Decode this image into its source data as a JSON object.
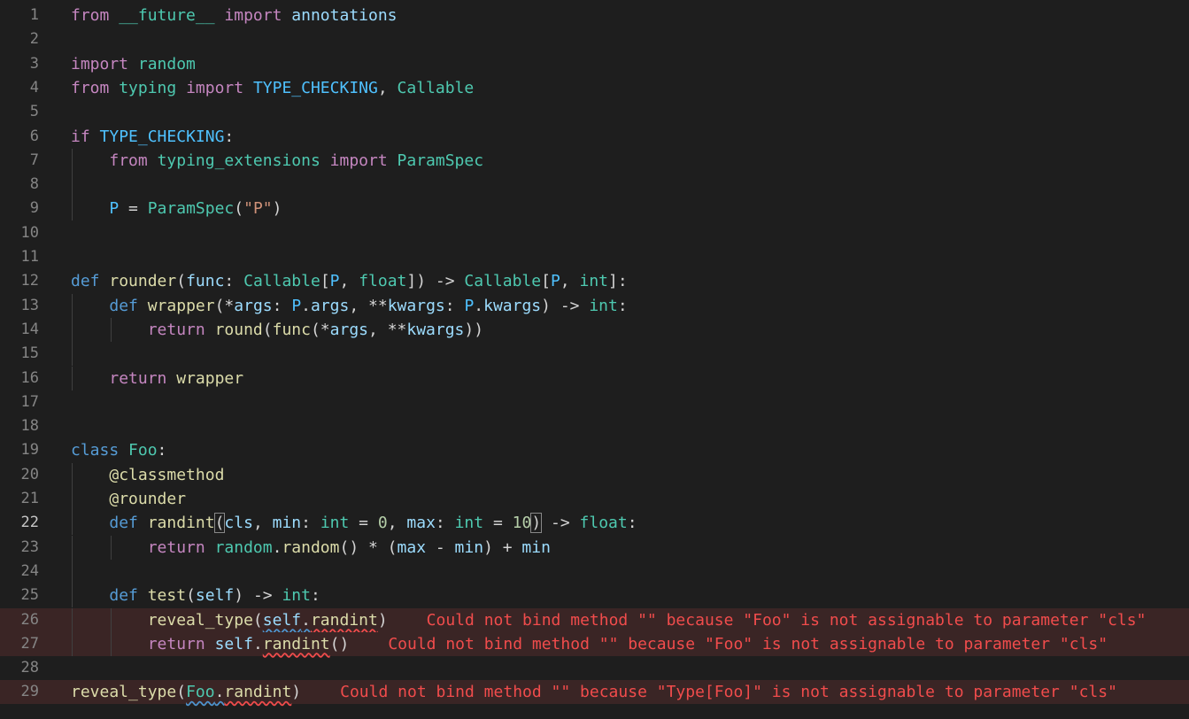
{
  "editor": {
    "language": "python",
    "active_line": 22,
    "colors": {
      "background": "#1e1e1e",
      "error_line": "#3a2525",
      "error_text": "#f14c4c",
      "keyword": "#c586c0",
      "storage": "#569cd6",
      "function": "#dcdcaa",
      "type": "#4ec9b0",
      "variable": "#9cdcfe",
      "string": "#ce9178",
      "number": "#b5cea8"
    },
    "line_numbers": [
      "1",
      "2",
      "3",
      "4",
      "5",
      "6",
      "7",
      "8",
      "9",
      "10",
      "11",
      "12",
      "13",
      "14",
      "15",
      "16",
      "17",
      "18",
      "19",
      "20",
      "21",
      "22",
      "23",
      "24",
      "25",
      "26",
      "27",
      "28",
      "29"
    ],
    "lines": [
      {
        "t": [
          [
            "kw",
            "from"
          ],
          [
            "op",
            " "
          ],
          [
            "ty",
            "__future__"
          ],
          [
            "op",
            " "
          ],
          [
            "kw",
            "import"
          ],
          [
            "op",
            " "
          ],
          [
            "var",
            "annotations"
          ]
        ]
      },
      {
        "t": []
      },
      {
        "t": [
          [
            "kw",
            "import"
          ],
          [
            "op",
            " "
          ],
          [
            "ty",
            "random"
          ]
        ]
      },
      {
        "t": [
          [
            "kw",
            "from"
          ],
          [
            "op",
            " "
          ],
          [
            "ty",
            "typing"
          ],
          [
            "op",
            " "
          ],
          [
            "kw",
            "import"
          ],
          [
            "op",
            " "
          ],
          [
            "con",
            "TYPE_CHECKING"
          ],
          [
            "op",
            ", "
          ],
          [
            "ty",
            "Callable"
          ]
        ]
      },
      {
        "t": []
      },
      {
        "t": [
          [
            "kw",
            "if"
          ],
          [
            "op",
            " "
          ],
          [
            "con",
            "TYPE_CHECKING"
          ],
          [
            "op",
            ":"
          ]
        ]
      },
      {
        "g": 1,
        "t": [
          [
            "op",
            "    "
          ],
          [
            "kw",
            "from"
          ],
          [
            "op",
            " "
          ],
          [
            "ty",
            "typing_extensions"
          ],
          [
            "op",
            " "
          ],
          [
            "kw",
            "import"
          ],
          [
            "op",
            " "
          ],
          [
            "ty",
            "ParamSpec"
          ]
        ]
      },
      {
        "g": 1,
        "t": []
      },
      {
        "g": 1,
        "t": [
          [
            "op",
            "    "
          ],
          [
            "con",
            "P"
          ],
          [
            "op",
            " = "
          ],
          [
            "ty",
            "ParamSpec"
          ],
          [
            "op",
            "("
          ],
          [
            "str",
            "\"P\""
          ],
          [
            "op",
            ")"
          ]
        ]
      },
      {
        "t": []
      },
      {
        "t": []
      },
      {
        "t": [
          [
            "kw2",
            "def"
          ],
          [
            "op",
            " "
          ],
          [
            "fn",
            "rounder"
          ],
          [
            "op",
            "("
          ],
          [
            "var",
            "func"
          ],
          [
            "op",
            ": "
          ],
          [
            "ty",
            "Callable"
          ],
          [
            "op",
            "["
          ],
          [
            "con",
            "P"
          ],
          [
            "op",
            ", "
          ],
          [
            "ty",
            "float"
          ],
          [
            "op",
            "]) -> "
          ],
          [
            "ty",
            "Callable"
          ],
          [
            "op",
            "["
          ],
          [
            "con",
            "P"
          ],
          [
            "op",
            ", "
          ],
          [
            "ty",
            "int"
          ],
          [
            "op",
            "]:"
          ]
        ]
      },
      {
        "g": 1,
        "t": [
          [
            "op",
            "    "
          ],
          [
            "kw2",
            "def"
          ],
          [
            "op",
            " "
          ],
          [
            "fn",
            "wrapper"
          ],
          [
            "op",
            "(*"
          ],
          [
            "var",
            "args"
          ],
          [
            "op",
            ": "
          ],
          [
            "con",
            "P"
          ],
          [
            "op",
            "."
          ],
          [
            "var",
            "args"
          ],
          [
            "op",
            ", **"
          ],
          [
            "var",
            "kwargs"
          ],
          [
            "op",
            ": "
          ],
          [
            "con",
            "P"
          ],
          [
            "op",
            "."
          ],
          [
            "var",
            "kwargs"
          ],
          [
            "op",
            ") -> "
          ],
          [
            "ty",
            "int"
          ],
          [
            "op",
            ":"
          ]
        ]
      },
      {
        "g": 2,
        "t": [
          [
            "op",
            "        "
          ],
          [
            "kw",
            "return"
          ],
          [
            "op",
            " "
          ],
          [
            "fn",
            "round"
          ],
          [
            "op",
            "("
          ],
          [
            "fn",
            "func"
          ],
          [
            "op",
            "(*"
          ],
          [
            "var",
            "args"
          ],
          [
            "op",
            ", **"
          ],
          [
            "var",
            "kwargs"
          ],
          [
            "op",
            "))"
          ]
        ]
      },
      {
        "g": 1,
        "t": []
      },
      {
        "g": 1,
        "t": [
          [
            "op",
            "    "
          ],
          [
            "kw",
            "return"
          ],
          [
            "op",
            " "
          ],
          [
            "fn",
            "wrapper"
          ]
        ]
      },
      {
        "t": []
      },
      {
        "t": []
      },
      {
        "t": [
          [
            "kw2",
            "class"
          ],
          [
            "op",
            " "
          ],
          [
            "ty",
            "Foo"
          ],
          [
            "op",
            ":"
          ]
        ]
      },
      {
        "g": 1,
        "t": [
          [
            "op",
            "    "
          ],
          [
            "fn",
            "@classmethod"
          ]
        ]
      },
      {
        "g": 1,
        "t": [
          [
            "op",
            "    "
          ],
          [
            "fn",
            "@rounder"
          ]
        ]
      },
      {
        "g": 1,
        "t": [
          [
            "op",
            "    "
          ],
          [
            "kw2",
            "def"
          ],
          [
            "op",
            " "
          ],
          [
            "fn",
            "randint"
          ],
          [
            "br",
            "("
          ],
          [
            "var",
            "cls"
          ],
          [
            "op",
            ", "
          ],
          [
            "var",
            "min"
          ],
          [
            "op",
            ": "
          ],
          [
            "ty",
            "int"
          ],
          [
            "op",
            " = "
          ],
          [
            "num",
            "0"
          ],
          [
            "op",
            ", "
          ],
          [
            "var",
            "max"
          ],
          [
            "op",
            ": "
          ],
          [
            "ty",
            "int"
          ],
          [
            "op",
            " = "
          ],
          [
            "num",
            "10"
          ],
          [
            "br",
            ")"
          ],
          [
            "op",
            " -> "
          ],
          [
            "ty",
            "float"
          ],
          [
            "op",
            ":"
          ]
        ]
      },
      {
        "g": 2,
        "t": [
          [
            "op",
            "        "
          ],
          [
            "kw",
            "return"
          ],
          [
            "op",
            " "
          ],
          [
            "ty",
            "random"
          ],
          [
            "op",
            "."
          ],
          [
            "fn",
            "random"
          ],
          [
            "op",
            "() * ("
          ],
          [
            "var",
            "max"
          ],
          [
            "op",
            " - "
          ],
          [
            "var",
            "min"
          ],
          [
            "op",
            ") + "
          ],
          [
            "var",
            "min"
          ]
        ]
      },
      {
        "g": 1,
        "t": []
      },
      {
        "g": 1,
        "t": [
          [
            "op",
            "    "
          ],
          [
            "kw2",
            "def"
          ],
          [
            "op",
            " "
          ],
          [
            "fn",
            "test"
          ],
          [
            "op",
            "("
          ],
          [
            "var",
            "self"
          ],
          [
            "op",
            ") -> "
          ],
          [
            "ty",
            "int"
          ],
          [
            "op",
            ":"
          ]
        ]
      },
      {
        "g": 2,
        "err": true,
        "t": [
          [
            "op",
            "        "
          ],
          [
            "fn",
            "reveal_type"
          ],
          [
            "op",
            "("
          ],
          [
            "var sq",
            "self"
          ],
          [
            "op sq",
            "."
          ],
          [
            "fn sqr",
            "randint"
          ],
          [
            "op",
            ")"
          ]
        ],
        "diag": "Could not bind method \"\" because \"Foo\" is not assignable to parameter \"cls\""
      },
      {
        "g": 2,
        "err": true,
        "t": [
          [
            "op",
            "        "
          ],
          [
            "kw",
            "return"
          ],
          [
            "op",
            " "
          ],
          [
            "var",
            "self"
          ],
          [
            "op",
            "."
          ],
          [
            "fn sqr",
            "randint"
          ],
          [
            "op",
            "()"
          ]
        ],
        "diag": "Could not bind method \"\" because \"Foo\" is not assignable to parameter \"cls\""
      },
      {
        "t": []
      },
      {
        "err": true,
        "t": [
          [
            "fn",
            "reveal_type"
          ],
          [
            "op",
            "("
          ],
          [
            "ty sq",
            "Foo"
          ],
          [
            "op sq",
            "."
          ],
          [
            "fn sqr",
            "randint"
          ],
          [
            "op",
            ")"
          ]
        ],
        "diag": "Could not bind method \"\" because \"Type[Foo]\" is not assignable to parameter \"cls\""
      }
    ]
  }
}
